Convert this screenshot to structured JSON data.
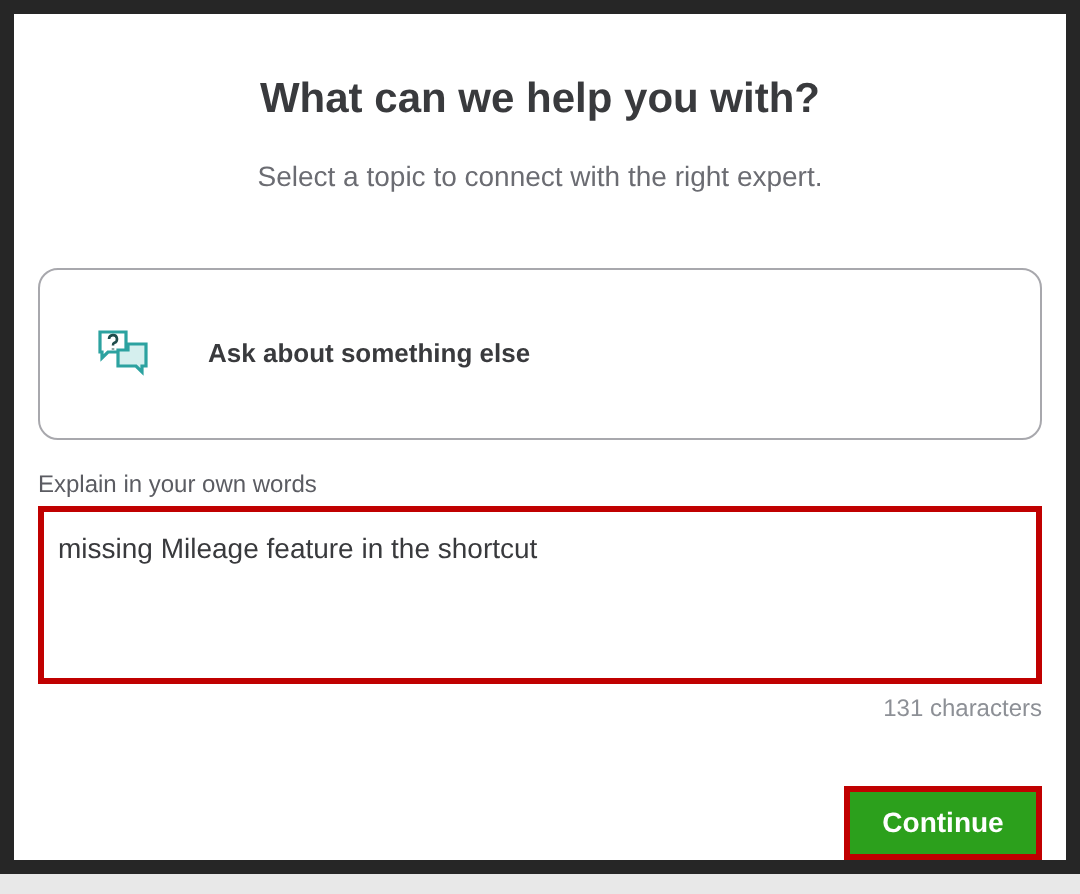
{
  "dialog": {
    "title": "What can we help you with?",
    "subtitle": "Select a topic to connect with the right expert."
  },
  "topic": {
    "label": "Ask about something else"
  },
  "explain": {
    "label": "Explain in your own words",
    "value": "missing Mileage feature in the shortcut",
    "highlighted": true,
    "count": "131 characters"
  },
  "continue_button": {
    "label": "Continue",
    "highlighted": true
  }
}
